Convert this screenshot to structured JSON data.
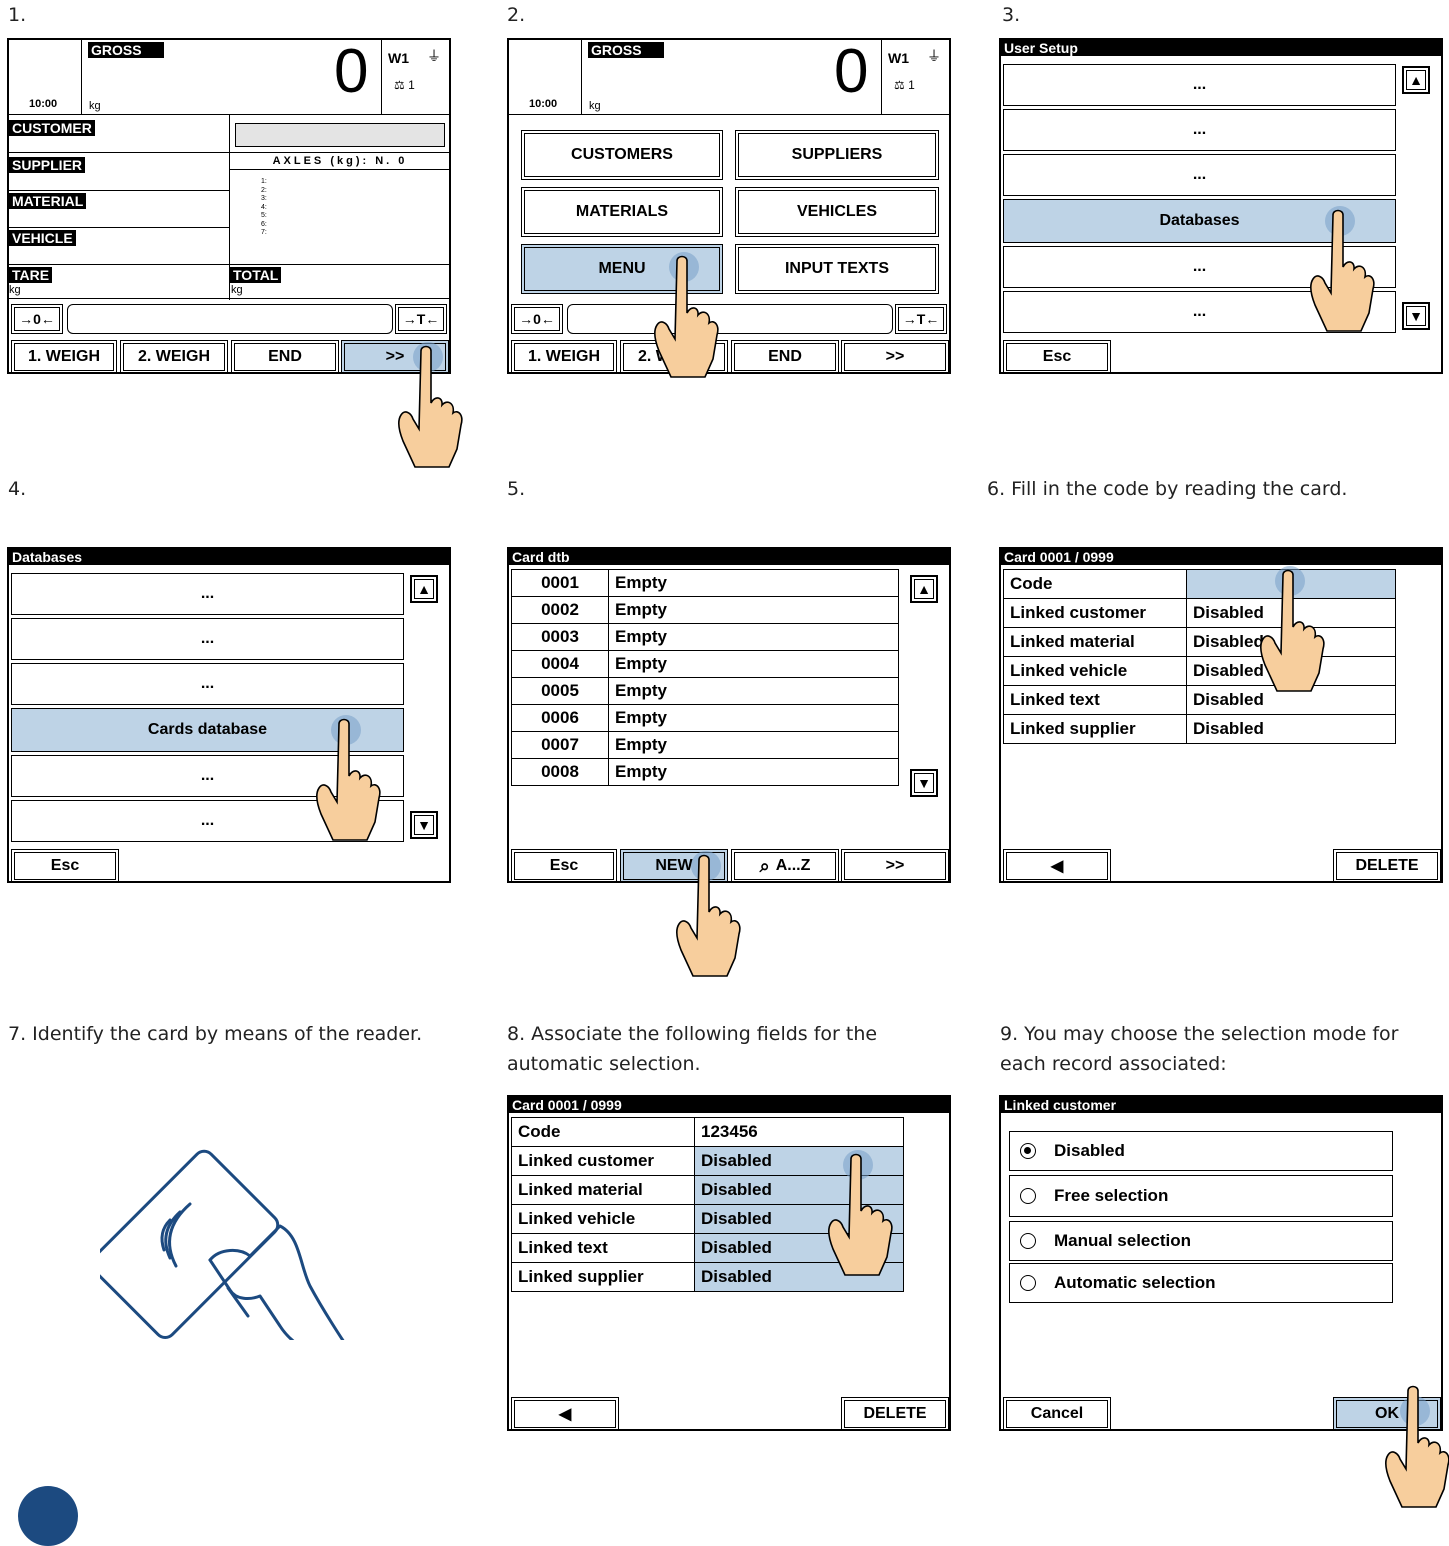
{
  "captions": {
    "s1": "1.",
    "s2": "2.",
    "s3": "3.",
    "s4": "4.",
    "s5": "5.",
    "s6": "6. Fill in the code by reading the card.",
    "s7": "7. Identify the card by means of the reader.",
    "s8": "8. Associate the following fields for the automatic selection.",
    "s9": "9. You may choose the selection mode for each record associated:"
  },
  "weigh_screen": {
    "gross": "GROSS",
    "time": "10:00",
    "unit": "kg",
    "weight": "0",
    "scale": "W1",
    "scale_num": "1",
    "customer": "CUSTOMER",
    "supplier": "SUPPLIER",
    "material": "MATERIAL",
    "vehicle": "VEHICLE",
    "tare": "TARE",
    "total": "TOTAL",
    "axles": "AXLES (kg): N. 0",
    "axle_lines": [
      "1:",
      "2:",
      "3:",
      "4:",
      "5:",
      "6:",
      "7:"
    ],
    "zero": "→0←",
    "tare_btn": "→T←",
    "buttons": [
      "1. WEIGH",
      "2. WEIGH",
      "END",
      ">>"
    ]
  },
  "menu_screen": {
    "buttons": [
      "CUSTOMERS",
      "SUPPLIERS",
      "MATERIALS",
      "VEHICLES",
      "MENU",
      "INPUT TEXTS"
    ],
    "bottom": [
      "1. WEIGH",
      "2. WEIGH",
      "END",
      ">>"
    ]
  },
  "user_setup": {
    "title": "User Setup",
    "items": [
      "...",
      "...",
      "...",
      "Databases",
      "...",
      "..."
    ],
    "esc": "Esc"
  },
  "databases": {
    "title": "Databases",
    "items": [
      "...",
      "...",
      "...",
      "Cards database",
      "...",
      "..."
    ],
    "esc": "Esc"
  },
  "card_dtb": {
    "title": "Card dtb",
    "rows": [
      [
        "0001",
        "Empty"
      ],
      [
        "0002",
        "Empty"
      ],
      [
        "0003",
        "Empty"
      ],
      [
        "0004",
        "Empty"
      ],
      [
        "0005",
        "Empty"
      ],
      [
        "0006",
        "Empty"
      ],
      [
        "0007",
        "Empty"
      ],
      [
        "0008",
        "Empty"
      ]
    ],
    "buttons": [
      "Esc",
      "NEW",
      "A...Z",
      ">>"
    ]
  },
  "card_edit": {
    "title": "Card 0001 / 0999",
    "rows": [
      [
        "Code",
        ""
      ],
      [
        "Linked customer",
        "Disabled"
      ],
      [
        "Linked material",
        "Disabled"
      ],
      [
        "Linked vehicle",
        "Disabled"
      ],
      [
        "Linked text",
        "Disabled"
      ],
      [
        "Linked supplier",
        "Disabled"
      ]
    ],
    "delete": "DELETE"
  },
  "card_edit2": {
    "title": "Card 0001 / 0999",
    "rows": [
      [
        "Code",
        "123456"
      ],
      [
        "Linked customer",
        "Disabled"
      ],
      [
        "Linked material",
        "Disabled"
      ],
      [
        "Linked vehicle",
        "Disabled"
      ],
      [
        "Linked text",
        "Disabled"
      ],
      [
        "Linked supplier",
        "Disabled"
      ]
    ],
    "delete": "DELETE"
  },
  "linked_customer": {
    "title": "Linked customer",
    "options": [
      "Disabled",
      "Free selection",
      "Manual selection",
      "Automatic selection"
    ],
    "selected": 0,
    "cancel": "Cancel",
    "ok": "OK"
  }
}
